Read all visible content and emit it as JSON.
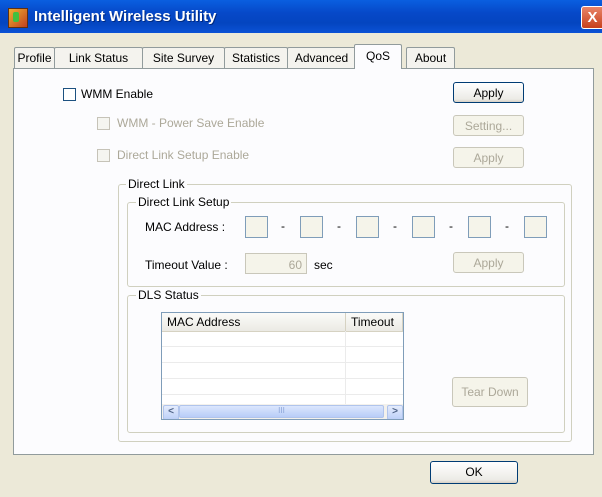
{
  "window": {
    "title": "Intelligent Wireless Utility",
    "close_glyph": "X"
  },
  "tabs": [
    {
      "label": "Profile"
    },
    {
      "label": "Link Status"
    },
    {
      "label": "Site Survey"
    },
    {
      "label": "Statistics"
    },
    {
      "label": "Advanced"
    },
    {
      "label": "QoS",
      "active": true
    },
    {
      "label": "About"
    }
  ],
  "qos": {
    "wmm_enable": {
      "label": "WMM Enable",
      "checked": false
    },
    "apply_label": "Apply",
    "power_save": {
      "label": "WMM - Power Save Enable",
      "checked": false,
      "enabled": false
    },
    "setting_label": "Setting...",
    "direct_link_setup_enable": {
      "label": "Direct Link Setup Enable",
      "checked": false,
      "enabled": false
    },
    "apply2_label": "Apply"
  },
  "direct_link": {
    "group_label": "Direct Link",
    "setup": {
      "group_label": "Direct Link Setup",
      "mac_label": "MAC Address :",
      "mac_separator": "-",
      "mac_octets": [
        "",
        "",
        "",
        "",
        "",
        ""
      ],
      "timeout_label": "Timeout Value :",
      "timeout_value": "60",
      "timeout_unit": "sec",
      "apply_label": "Apply"
    },
    "dls_status": {
      "group_label": "DLS Status",
      "columns": [
        "MAC Address",
        "Timeout"
      ],
      "rows": [],
      "teardown_label": "Tear Down",
      "scroll_left": "<",
      "scroll_right": ">",
      "thumb_grip": "III"
    }
  },
  "footer": {
    "ok_label": "OK"
  }
}
